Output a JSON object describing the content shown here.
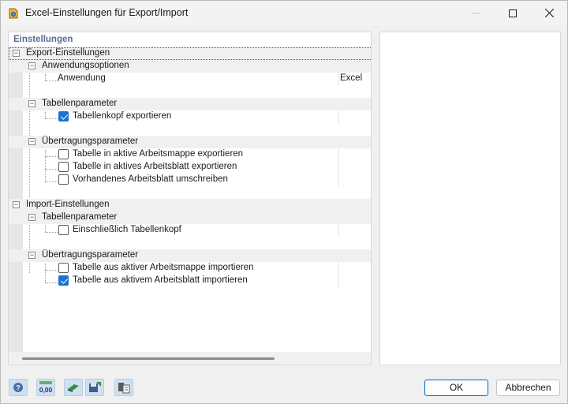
{
  "window": {
    "title": "Excel-Einstellungen für Export/Import"
  },
  "panel": {
    "header": "Einstellungen"
  },
  "tree": {
    "export_section": "Export-Einstellungen",
    "app_options": "Anwendungsoptionen",
    "application_label": "Anwendung",
    "application_value": "Excel",
    "export_table_params": "Tabellenparameter",
    "export_table_header": "Tabellenkopf exportieren",
    "export_transfer_params": "Übertragungsparameter",
    "export_to_active_workbook": "Tabelle in aktive Arbeitsmappe exportieren",
    "export_to_active_sheet": "Tabelle in aktives Arbeitsblatt exportieren",
    "overwrite_sheet": "Vorhandenes Arbeitsblatt umschreiben",
    "import_section": "Import-Einstellungen",
    "import_table_params": "Tabellenparameter",
    "including_header": "Einschließlich Tabellenkopf",
    "import_transfer_params": "Übertragungsparameter",
    "import_from_active_workbook": "Tabelle aus aktiver Arbeitsmappe importieren",
    "import_from_active_sheet": "Tabelle aus aktivem Arbeitsblatt importieren"
  },
  "checkboxes": {
    "export_table_header": true,
    "export_to_active_workbook": false,
    "export_to_active_sheet": false,
    "overwrite_sheet": false,
    "including_header": false,
    "import_from_active_workbook": false,
    "import_from_active_sheet": true
  },
  "toolbar": {
    "icons": [
      "help-icon",
      "decimal-format-icon",
      "units-icon",
      "save-settings-icon",
      "load-settings-icon"
    ]
  },
  "buttons": {
    "ok": "OK",
    "cancel": "Abbrechen"
  },
  "colors": {
    "accent": "#1a73d0",
    "header_text": "#5b6b94"
  }
}
